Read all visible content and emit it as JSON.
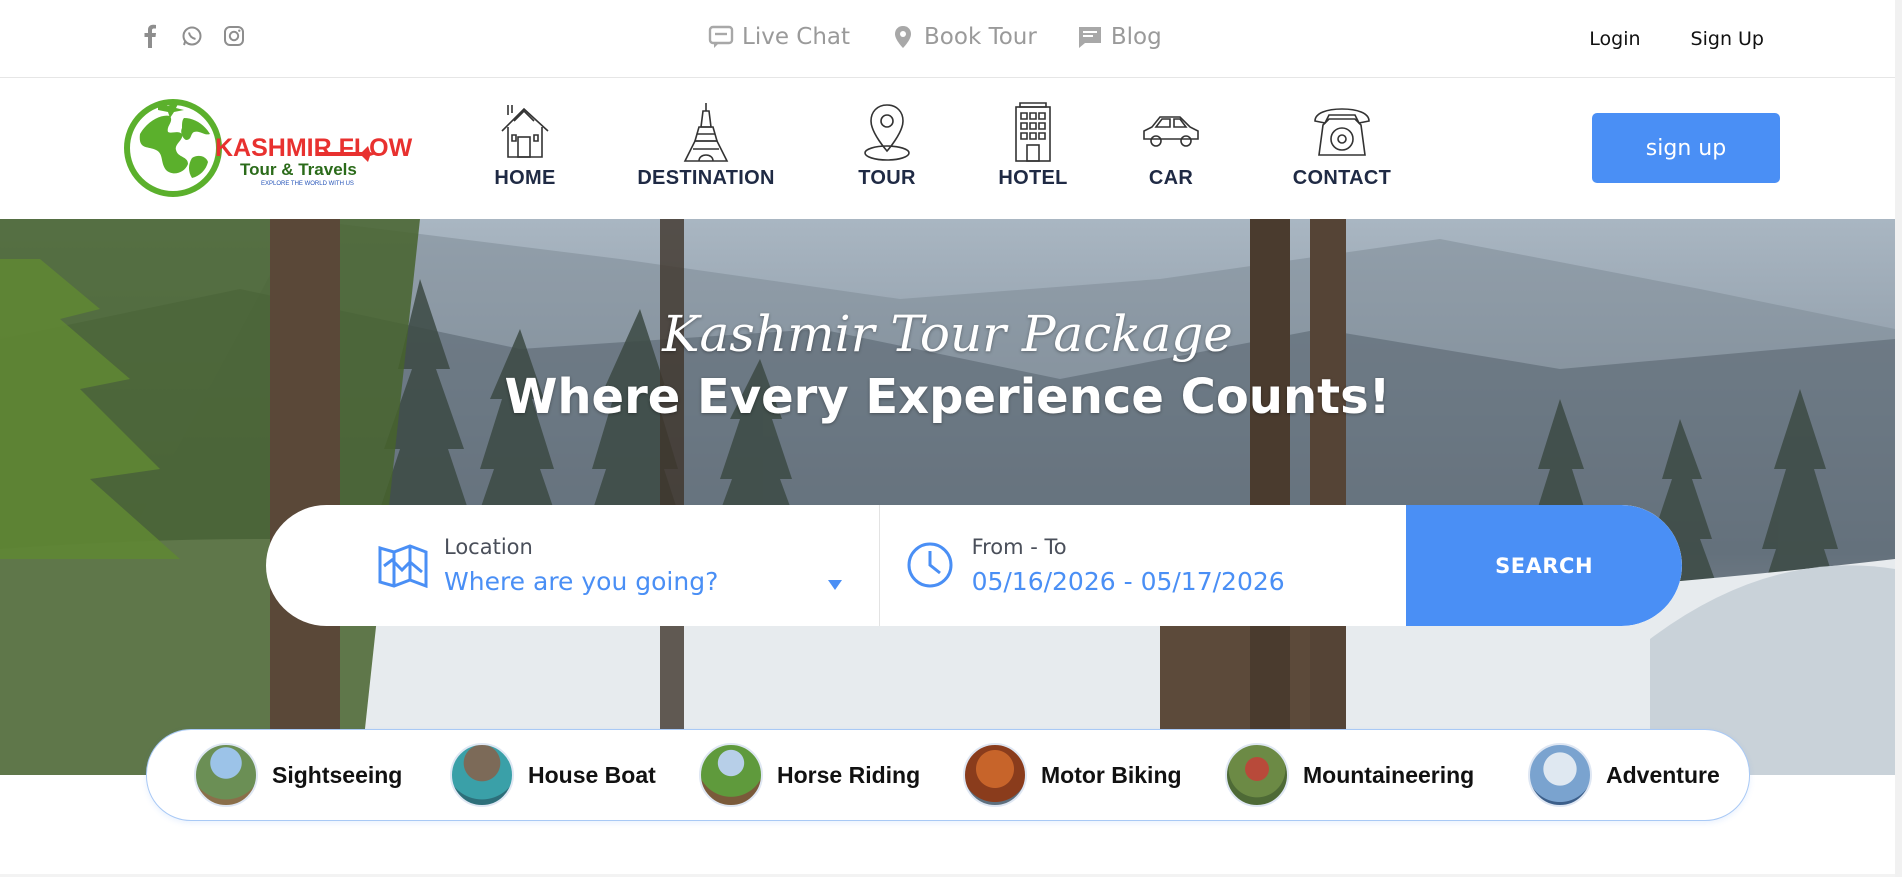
{
  "topbar": {
    "social_icons": [
      "facebook-icon",
      "whatsapp-icon",
      "instagram-icon"
    ],
    "links": [
      {
        "label": "Live Chat",
        "icon": "chat-icon"
      },
      {
        "label": "Book Tour",
        "icon": "location-pin-icon"
      },
      {
        "label": "Blog",
        "icon": "blog-icon"
      }
    ],
    "login": "Login",
    "signup": "Sign Up"
  },
  "logo": {
    "name": "KASHMIR FLOW",
    "subtitle": "Tour & Travels",
    "tagline": "EXPLORE THE WORLD WITH US"
  },
  "nav": {
    "items": [
      {
        "label": "HOME",
        "icon": "house-icon"
      },
      {
        "label": "DESTINATION",
        "icon": "eiffel-tower-icon"
      },
      {
        "label": "TOUR",
        "icon": "map-pin-icon"
      },
      {
        "label": "HOTEL",
        "icon": "hotel-building-icon"
      },
      {
        "label": "CAR",
        "icon": "car-icon"
      },
      {
        "label": "CONTACT",
        "icon": "telephone-icon"
      }
    ],
    "signup_label": "sign up"
  },
  "hero": {
    "title_line1": "Kashmir Tour Package",
    "title_line2": "Where Every Experience Counts!"
  },
  "search": {
    "location_label": "Location",
    "location_value": "Where are you going?",
    "date_label": "From - To",
    "date_value": "05/16/2026 - 05/17/2026",
    "button_label": "SEARCH"
  },
  "activities": [
    {
      "label": "Sightseeing"
    },
    {
      "label": "House Boat"
    },
    {
      "label": "Horse Riding"
    },
    {
      "label": "Motor Biking"
    },
    {
      "label": "Mountaineering"
    },
    {
      "label": "Adventure"
    }
  ],
  "colors": {
    "accent": "#4a8ff5",
    "nav_text": "#1f2a44",
    "muted": "#9a9a9a"
  }
}
